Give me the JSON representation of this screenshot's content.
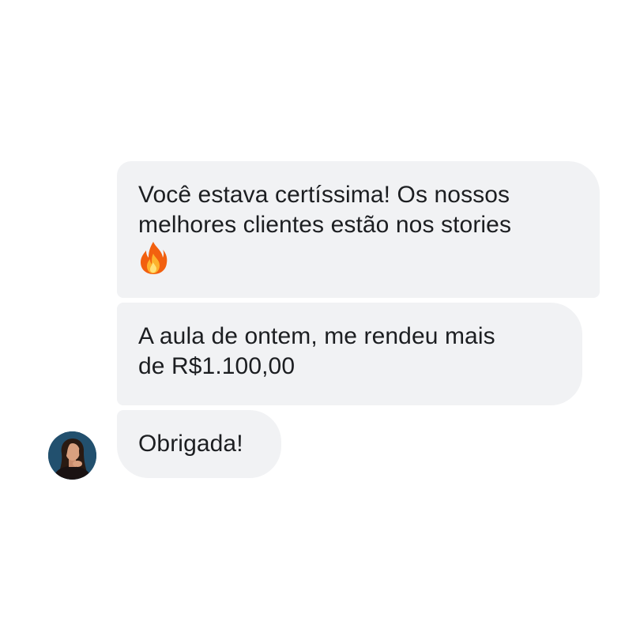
{
  "conversation": {
    "messages": [
      {
        "lines": [
          "Você estava certíssima! Os nossos",
          "melhores clientes estão nos stories"
        ],
        "emoji_icon": "fire-icon"
      },
      {
        "lines": [
          "A aula de ontem, me rendeu mais",
          "de R$1.100,00"
        ]
      },
      {
        "lines": [
          "Obrigada!"
        ]
      }
    ],
    "sender_avatar": "avatar-photo-woman"
  },
  "colors": {
    "bubble_background": "#f1f2f4",
    "text": "#1c1e21",
    "page_background": "#ffffff"
  }
}
